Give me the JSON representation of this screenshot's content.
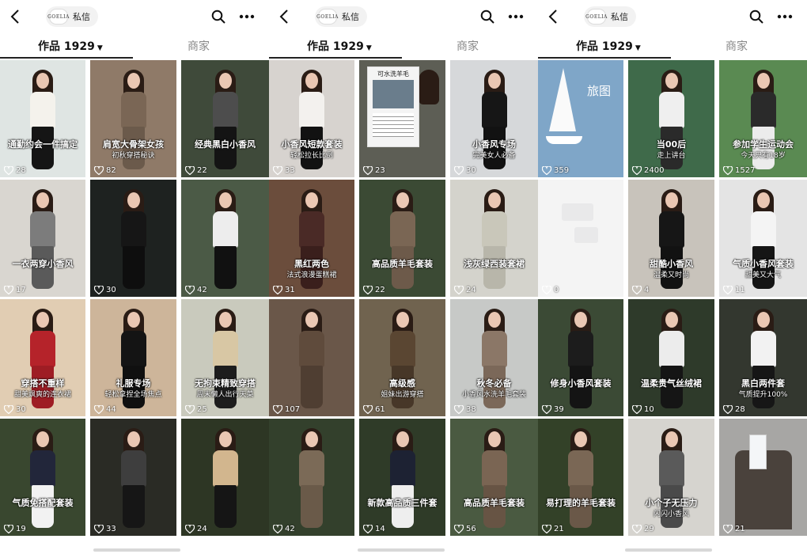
{
  "header": {
    "chat_label": "私信",
    "brand_mark": "GOELIA"
  },
  "tabs": {
    "works": "作品 1929",
    "shop": "商家"
  },
  "colors": {
    "text": "#111111",
    "muted": "#888888",
    "underline": "#222222",
    "pill": "#f2f2f2"
  },
  "icons": {
    "back": "back-arrow-icon",
    "search": "search-icon",
    "more": "more-icon",
    "like": "heart-icon"
  },
  "panels": [
    {
      "cells": [
        {
          "caption": "通勤约会一件搞定",
          "sub": "",
          "likes": "28",
          "bg": "#dfe5e3",
          "top": "#f4f2ec",
          "bottom": "#151515",
          "style": "person"
        },
        {
          "caption": "肩宽大骨架女孩",
          "sub": "初秋穿搭秘诀",
          "likes": "82",
          "bg": "#8f7a68",
          "top": "#7a6655",
          "bottom": "#6b5a4b",
          "style": "person"
        },
        {
          "caption": "经典黑白小香风",
          "sub": "",
          "likes": "22",
          "bg": "#3f4a3a",
          "top": "#4d4d4d",
          "bottom": "#141414",
          "style": "person"
        },
        {
          "caption": "一衣两穿小香风",
          "sub": "",
          "likes": "17",
          "bg": "#d9d6d0",
          "top": "#7c7c7c",
          "bottom": "#5a5a5a",
          "style": "person"
        },
        {
          "caption": "",
          "sub": "",
          "likes": "30",
          "bg": "#1e2220",
          "top": "#161616",
          "bottom": "#0e0e0e",
          "style": "person"
        },
        {
          "caption": "",
          "sub": "",
          "likes": "42",
          "bg": "#4b5a46",
          "top": "#ededed",
          "bottom": "#111111",
          "style": "person"
        },
        {
          "caption": "穿搭不重样",
          "sub": "甜美飒爽的连衣裙",
          "likes": "30",
          "bg": "#e1cdb3",
          "top": "#b5232a",
          "bottom": "#9e1d24",
          "style": "person"
        },
        {
          "caption": "礼服专场",
          "sub": "轻松拿捏全场焦点",
          "likes": "44",
          "bg": "#cdb59a",
          "top": "#141414",
          "bottom": "#101010",
          "style": "person"
        },
        {
          "caption": "无拘束精致穿搭",
          "sub": "周末懒人出行天菜",
          "likes": "25",
          "bg": "#c9cabd",
          "top": "#d8c7a4",
          "bottom": "#1d1d1d",
          "style": "person"
        },
        {
          "caption": "气质免搭配套装",
          "sub": "",
          "likes": "19",
          "bg": "#39472f",
          "top": "#22263a",
          "bottom": "#f2f2f2",
          "style": "person"
        },
        {
          "caption": "",
          "sub": "",
          "likes": "33",
          "bg": "#2a2b25",
          "top": "#3e3e3e",
          "bottom": "#161616",
          "style": "person"
        },
        {
          "caption": "",
          "sub": "",
          "likes": "24",
          "bg": "#2d3624",
          "top": "#d2b68e",
          "bottom": "#151515",
          "style": "person"
        }
      ]
    },
    {
      "cells": [
        {
          "caption": "小香风短款套装",
          "sub": "轻松拉长比例",
          "likes": "33",
          "bg": "#d7d3cf",
          "top": "#f3f1ee",
          "bottom": "#121212",
          "style": "person"
        },
        {
          "caption": "",
          "sub": "",
          "likes": "23",
          "bg": "#5d5e55",
          "top": "#7a7a70",
          "bottom": "#4f4f48",
          "style": "poster",
          "poster_title": "可水洗羊毛"
        },
        {
          "caption": "小香风专场",
          "sub": "完美女人必备",
          "likes": "30",
          "bg": "#d6d8da",
          "top": "#161616",
          "bottom": "#121212",
          "style": "person"
        },
        {
          "caption": "黑红两色",
          "sub": "法式浪漫蛋糕裙",
          "likes": "31",
          "bg": "#6b4d3c",
          "top": "#4a2a26",
          "bottom": "#3a1f1c",
          "style": "person"
        },
        {
          "caption": "高品质羊毛套装",
          "sub": "",
          "likes": "22",
          "bg": "#3b4a34",
          "top": "#7a6654",
          "bottom": "#6d5a4a",
          "style": "person"
        },
        {
          "caption": "浅灰绿西装套裙",
          "sub": "",
          "likes": "24",
          "bg": "#d4d3cc",
          "top": "#c9c7ba",
          "bottom": "#b8b6aa",
          "style": "person"
        },
        {
          "caption": "",
          "sub": "",
          "likes": "107",
          "bg": "#6a5749",
          "top": "#5f4b3c",
          "bottom": "#4f3e32",
          "style": "person"
        },
        {
          "caption": "高级感",
          "sub": "姐妹出游穿搭",
          "likes": "61",
          "bg": "#70634f",
          "top": "#5a4632",
          "bottom": "#473728",
          "style": "person"
        },
        {
          "caption": "秋冬必备",
          "sub": "小香风水洗羊毛套装",
          "likes": "38",
          "bg": "#c7c9c7",
          "top": "#8b7767",
          "bottom": "#7b6859",
          "style": "person"
        },
        {
          "caption": "",
          "sub": "",
          "likes": "42",
          "bg": "#33402c",
          "top": "#7b6a57",
          "bottom": "#6a5a49",
          "style": "person"
        },
        {
          "caption": "新款高品质三件套",
          "sub": "",
          "likes": "14",
          "bg": "#2f3b28",
          "top": "#1d2233",
          "bottom": "#eeeeee",
          "style": "person"
        },
        {
          "caption": "高品质羊毛套装",
          "sub": "",
          "likes": "56",
          "bg": "#4a5a41",
          "top": "#7a6553",
          "bottom": "#675444",
          "style": "person"
        }
      ]
    },
    {
      "cells": [
        {
          "caption": "",
          "sub": "",
          "likes": "359",
          "bg": "#7fa6c8",
          "top": "",
          "bottom": "",
          "style": "boat",
          "brand_text": "旅图"
        },
        {
          "caption": "当00后",
          "sub": "走上讲台",
          "likes": "2400",
          "bg": "#3f6a4a",
          "top": "#efefef",
          "bottom": "#2a2a2a",
          "style": "person"
        },
        {
          "caption": "参加学生运动会",
          "sub": "今天只有18岁",
          "likes": "1527",
          "bg": "#5a8a52",
          "top": "#2a2a2a",
          "bottom": "#ececec",
          "style": "person"
        },
        {
          "caption": "",
          "sub": "",
          "likes": "0",
          "bg": "#f4f4f4",
          "top": "",
          "bottom": "",
          "style": "sleeve"
        },
        {
          "caption": "甜酷小香风",
          "sub": "温柔又时尚",
          "likes": "4",
          "bg": "#c8c3bb",
          "top": "#161616",
          "bottom": "#121212",
          "style": "person"
        },
        {
          "caption": "气质小香风套装",
          "sub": "甜美又大气",
          "likes": "11",
          "bg": "#e4e4e4",
          "top": "#f4f4f4",
          "bottom": "#151515",
          "style": "person"
        },
        {
          "caption": "修身小香风套装",
          "sub": "",
          "likes": "39",
          "bg": "#3b4a35",
          "top": "#1c1c1c",
          "bottom": "#141414",
          "style": "person"
        },
        {
          "caption": "温柔贵气丝绒裙",
          "sub": "",
          "likes": "10",
          "bg": "#2e3a2a",
          "top": "#ececec",
          "bottom": "#151515",
          "style": "person"
        },
        {
          "caption": "黑白两件套",
          "sub": "气质提升100%",
          "likes": "28",
          "bg": "#33372f",
          "top": "#f2f2f2",
          "bottom": "#161616",
          "style": "person"
        },
        {
          "caption": "易打理的羊毛套装",
          "sub": "",
          "likes": "21",
          "bg": "#334128",
          "top": "#7a6755",
          "bottom": "#6a5848",
          "style": "person"
        },
        {
          "caption": "小个子无压力",
          "sub": "闪闪小香风",
          "likes": "29",
          "bg": "#d6d4cf",
          "top": "#5a5a5a",
          "bottom": "#4a4a4a",
          "style": "person"
        },
        {
          "caption": "",
          "sub": "",
          "likes": "21",
          "bg": "#a7a6a4",
          "top": "",
          "bottom": "",
          "style": "coat"
        }
      ]
    }
  ]
}
